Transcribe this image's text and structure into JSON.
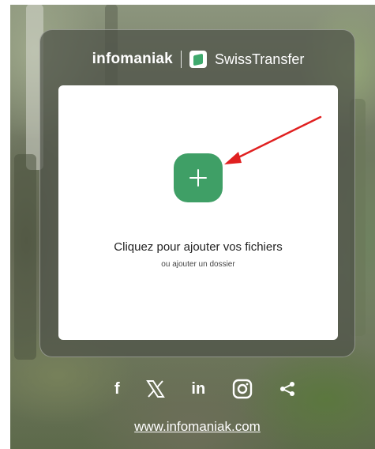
{
  "brand": {
    "company": "infomaniak",
    "product": "SwissTransfer"
  },
  "dropzone": {
    "title": "Cliquez pour ajouter vos fichiers",
    "folder_link": "ou ajouter un dossier"
  },
  "socials": {
    "facebook": "f",
    "linkedin": "in",
    "icons": [
      "facebook-icon",
      "x-icon",
      "linkedin-icon",
      "instagram-icon",
      "share-icon"
    ]
  },
  "footer": {
    "website": "www.infomaniak.com"
  },
  "colors": {
    "accent": "#3f9f66",
    "annotation_arrow": "#e02020"
  }
}
